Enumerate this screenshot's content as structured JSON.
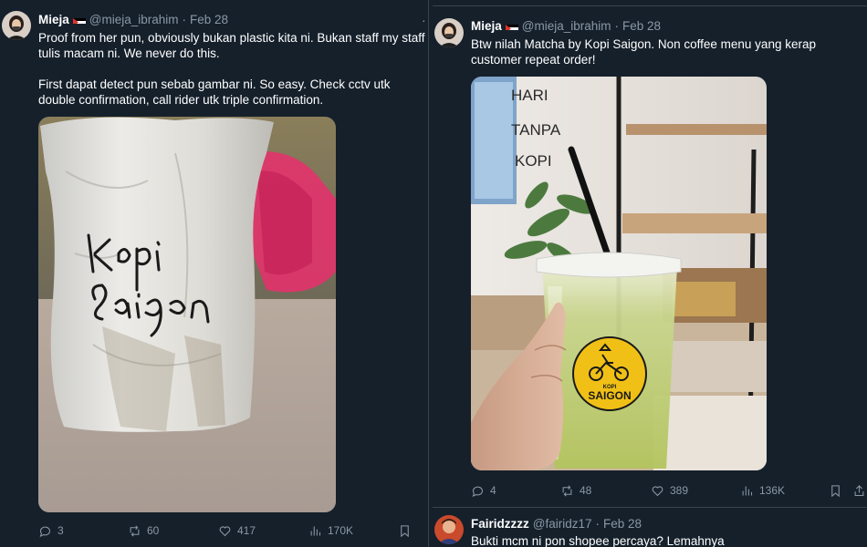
{
  "left_tweet": {
    "author_name": "Mieja",
    "author_handle": "@mieja_ibrahim",
    "dot": "·",
    "date": "Feb 28",
    "more": "···",
    "text_lines": [
      "Proof from her pun, obviously bukan plastic kita ni. Bukan staff my staff tulis macam ni. We never do this.",
      "First dapat detect pun sebab gambar ni. So easy. Check cctv utk double confirmation, call rider utk triple confirmation."
    ],
    "bag_handwriting": [
      "Kopi",
      "Saigon"
    ],
    "stats": {
      "replies": "3",
      "reposts": "60",
      "likes": "417",
      "views": "170K"
    }
  },
  "right_tweet": {
    "author_name": "Mieja",
    "author_handle": "@mieja_ibrahim",
    "dot": "·",
    "date": "Feb 28",
    "more": "···",
    "text": "Btw nilah Matcha by Kopi Saigon. Non coffee menu yang kerap customer repeat order!",
    "wall_text": [
      "HARI",
      "TANPA",
      "KOPI"
    ],
    "cup_logo_small": "KOPI",
    "cup_logo_big": "SAIGON",
    "stats": {
      "replies": "4",
      "reposts": "48",
      "likes": "389",
      "views": "136K"
    }
  },
  "reply_tweet": {
    "author_name": "Fairidzzzz",
    "author_handle": "@fairidz17",
    "dot": "·",
    "date": "Feb 28",
    "more": "···",
    "text": "Bukti mcm ni pon shopee percaya? Lemahnya"
  },
  "colors": {
    "background": "#15202b",
    "text_primary": "#ffffff",
    "text_secondary": "#8b98a5",
    "divider": "#38444d"
  }
}
